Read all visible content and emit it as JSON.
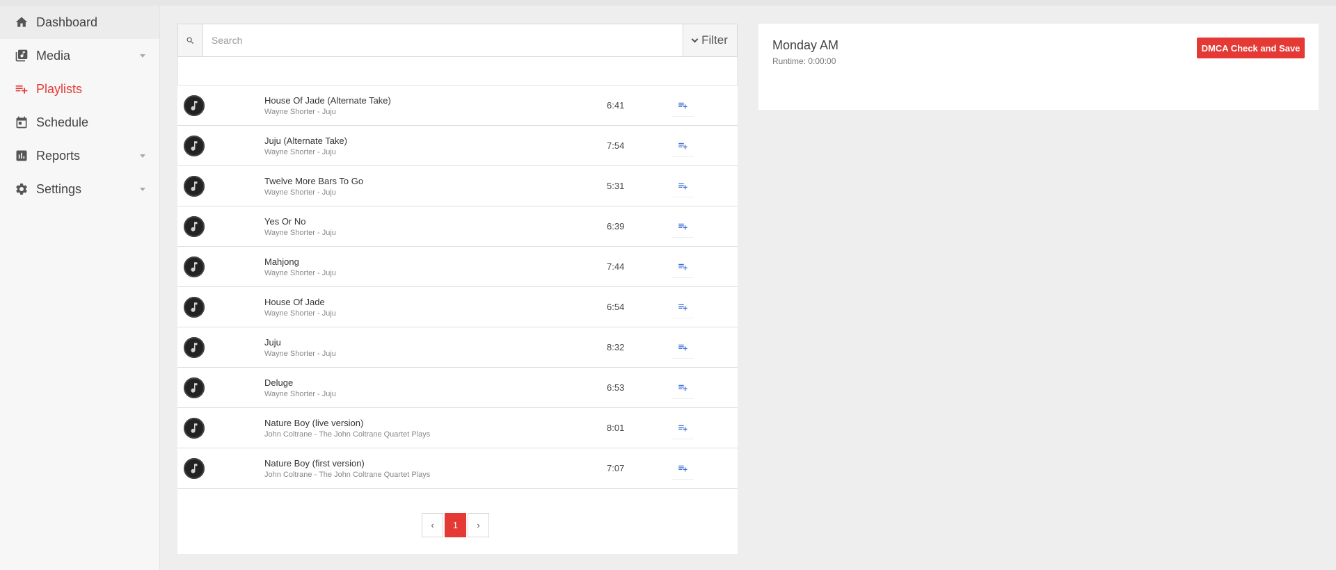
{
  "sidebar": {
    "items": [
      {
        "label": "Dashboard",
        "icon": "home-icon",
        "active": false,
        "expandable": false
      },
      {
        "label": "Media",
        "icon": "library-music-icon",
        "active": false,
        "expandable": true
      },
      {
        "label": "Playlists",
        "icon": "playlist-add-icon",
        "active": true,
        "expandable": false
      },
      {
        "label": "Schedule",
        "icon": "calendar-icon",
        "active": false,
        "expandable": false
      },
      {
        "label": "Reports",
        "icon": "bar-chart-icon",
        "active": false,
        "expandable": true
      },
      {
        "label": "Settings",
        "icon": "gear-icon",
        "active": false,
        "expandable": true
      }
    ]
  },
  "search": {
    "placeholder": "Search",
    "value": "",
    "filter_label": "Filter"
  },
  "tracks": [
    {
      "title": "House Of Jade (Alternate Take)",
      "subtitle": "Wayne Shorter - Juju",
      "duration": "6:41"
    },
    {
      "title": "Juju (Alternate Take)",
      "subtitle": "Wayne Shorter - Juju",
      "duration": "7:54"
    },
    {
      "title": "Twelve More Bars To Go",
      "subtitle": "Wayne Shorter - Juju",
      "duration": "5:31"
    },
    {
      "title": "Yes Or No",
      "subtitle": "Wayne Shorter - Juju",
      "duration": "6:39"
    },
    {
      "title": "Mahjong",
      "subtitle": "Wayne Shorter - Juju",
      "duration": "7:44"
    },
    {
      "title": "House Of Jade",
      "subtitle": "Wayne Shorter - Juju",
      "duration": "6:54"
    },
    {
      "title": "Juju",
      "subtitle": "Wayne Shorter - Juju",
      "duration": "8:32"
    },
    {
      "title": "Deluge",
      "subtitle": "Wayne Shorter - Juju",
      "duration": "6:53"
    },
    {
      "title": "Nature Boy (live version)",
      "subtitle": "John Coltrane - The John Coltrane Quartet Plays",
      "duration": "8:01"
    },
    {
      "title": "Nature Boy (first version)",
      "subtitle": "John Coltrane - The John Coltrane Quartet Plays",
      "duration": "7:07"
    }
  ],
  "pagination": {
    "prev_label": "‹",
    "current_page": "1",
    "next_label": "›"
  },
  "playlist": {
    "name": "Monday AM",
    "runtime": "Runtime: 0:00:00",
    "dmca_button": "DMCA Check and Save"
  },
  "colors": {
    "accent": "#e53935",
    "add_icon": "#3b6fd8"
  }
}
